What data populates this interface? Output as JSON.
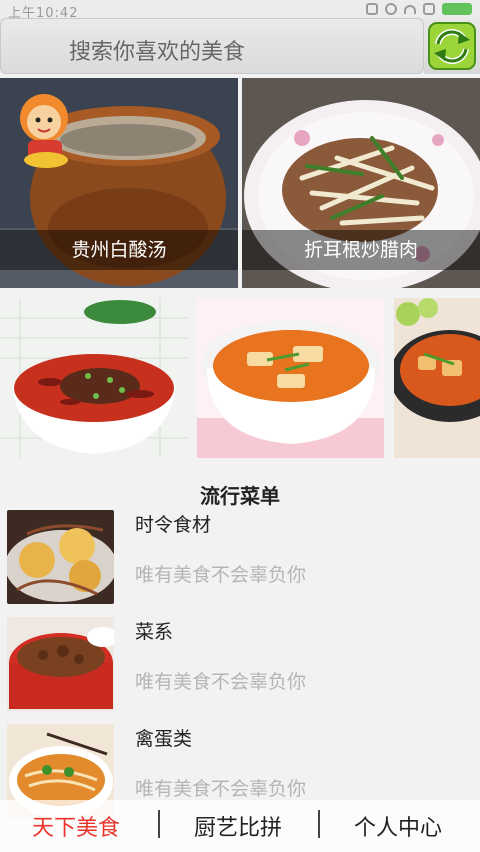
{
  "status_bar": {
    "time": "上午10:42"
  },
  "search": {
    "placeholder": "搜索你喜欢的美食",
    "refresh_icon": "refresh-icon"
  },
  "banner": [
    {
      "label": "贵州白酸汤"
    },
    {
      "label": "折耳根炒腊肉"
    }
  ],
  "section": {
    "title": "流行菜单"
  },
  "menu_items": [
    {
      "title": "时令食材",
      "subtitle": "唯有美食不会辜负你"
    },
    {
      "title": "菜系",
      "subtitle": "唯有美食不会辜负你"
    },
    {
      "title": "禽蛋类",
      "subtitle": "唯有美食不会辜负你"
    }
  ],
  "bottom_nav": {
    "items": [
      "天下美食",
      "厨艺比拼",
      "个人中心"
    ],
    "active_color": "#e8342b"
  }
}
